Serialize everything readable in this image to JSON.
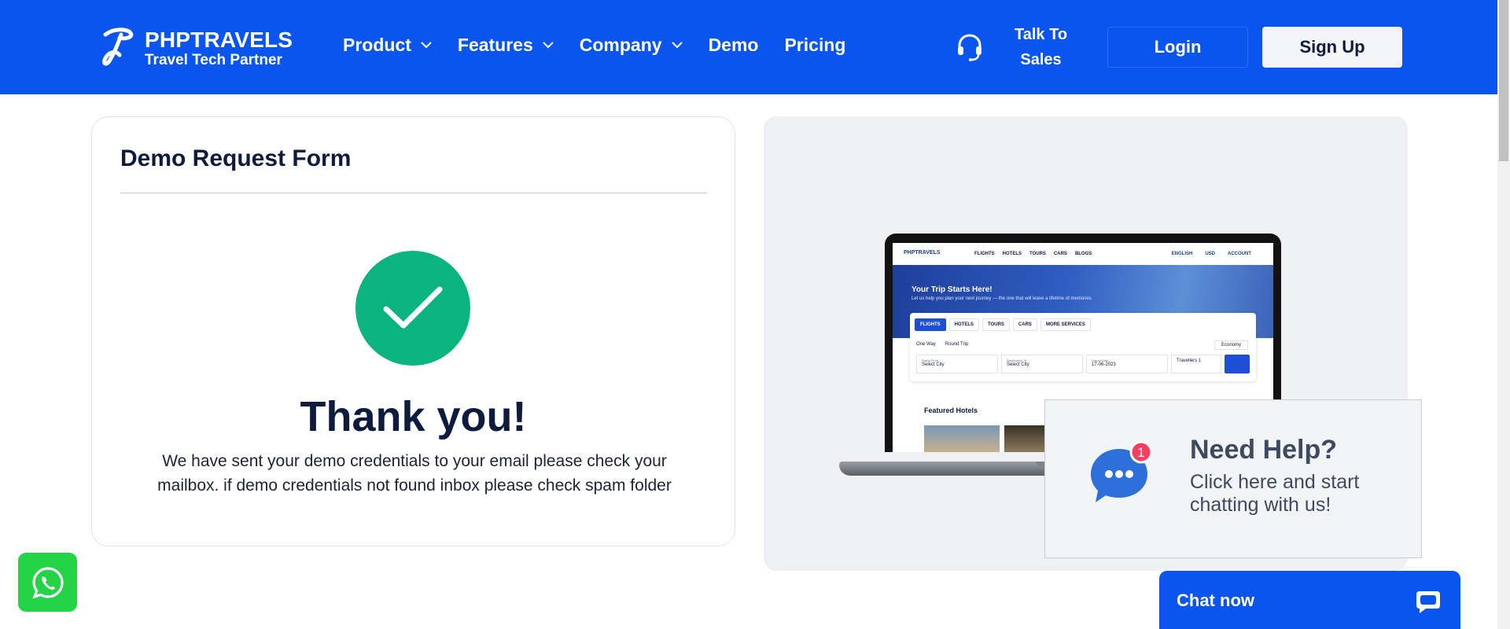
{
  "header": {
    "logo_title": "PHPTRAVELS",
    "logo_subtitle": "Travel Tech Partner",
    "nav": [
      {
        "label": "Product",
        "has_dropdown": true
      },
      {
        "label": "Features",
        "has_dropdown": true
      },
      {
        "label": "Company",
        "has_dropdown": true
      },
      {
        "label": "Demo",
        "has_dropdown": false
      },
      {
        "label": "Pricing",
        "has_dropdown": false
      }
    ],
    "talk_line1": "Talk To",
    "talk_line2": "Sales",
    "login_label": "Login",
    "signup_label": "Sign Up"
  },
  "form": {
    "title": "Demo Request Form",
    "thank_title": "Thank you!",
    "thank_line1": "We have sent your demo credentials to your email please check your",
    "thank_line2": "mailbox. if demo credentials not found inbox please check spam folder"
  },
  "preview": {
    "logo": "PHPTRAVELS",
    "links": [
      "FLIGHTS",
      "HOTELS",
      "TOURS",
      "CARS",
      "BLOGS"
    ],
    "right": [
      "ENGLISH",
      "USD",
      "ACCOUNT"
    ],
    "hero_title": "Your Trip Starts Here!",
    "hero_sub": "Let us help you plan your next journey — the one that will leave a lifetime of memories",
    "tabs": [
      "FLIGHTS",
      "HOTELS",
      "TOURS",
      "CARS",
      "MORE SERVICES"
    ],
    "trip_options": [
      "One Way",
      "Round Trip"
    ],
    "class_value": "Economy",
    "from_label": "Flying From",
    "from_value": "Select City",
    "to_label": "Destination To",
    "to_value": "Select City",
    "date_label": "Depart Date",
    "date_value": "17-06-2023",
    "travellers": "Travellers 1",
    "featured": "Featured Hotels"
  },
  "help": {
    "badge": "1",
    "title": "Need Help?",
    "line1": "Click here and start",
    "line2": "chatting with us!"
  },
  "chat_now": {
    "label": "Chat now"
  },
  "colors": {
    "brand_blue": "#0a55ee",
    "success_green": "#0bb37e",
    "whatsapp_green": "#25d347",
    "badge_red": "#f43f5e"
  },
  "icons": [
    "logo-icon",
    "chevron-down-icon",
    "headset-icon",
    "check-icon",
    "chat-bubble-icon",
    "chat-icon",
    "whatsapp-icon"
  ]
}
